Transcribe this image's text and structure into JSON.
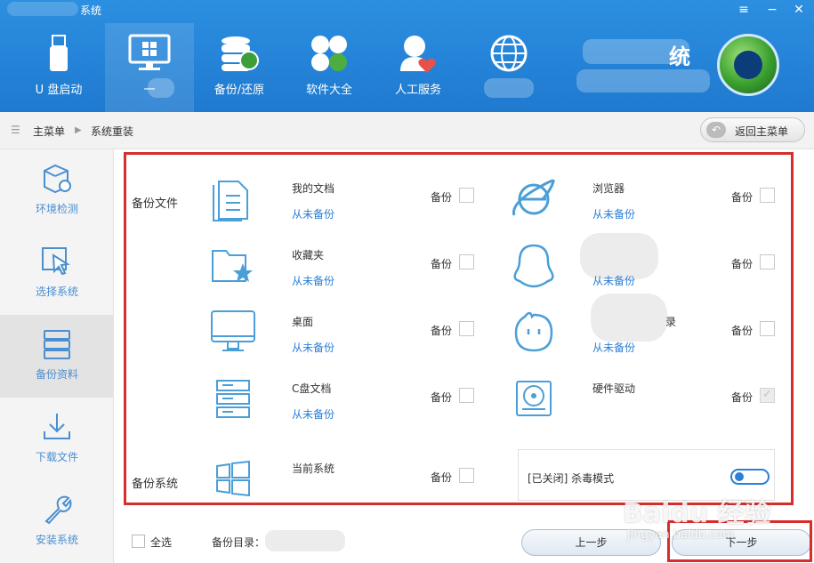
{
  "window": {
    "title": "系统",
    "controls": [
      "≡",
      "−",
      "✕"
    ]
  },
  "nav": {
    "tabs": [
      {
        "label": "U 盘启动",
        "icon": "usb-icon"
      },
      {
        "label": "一",
        "icon": "monitor-windows-icon"
      },
      {
        "label": "备份/还原",
        "icon": "database-icon"
      },
      {
        "label": "软件大全",
        "icon": "apps-icon"
      },
      {
        "label": "人工服务",
        "icon": "user-heart-icon"
      },
      {
        "label": "",
        "icon": "globe-icon"
      }
    ],
    "brand": "统"
  },
  "breadcrumb": {
    "root": "主菜单",
    "current": "系统重装",
    "back_label": "返回主菜单"
  },
  "sidebar": {
    "items": [
      {
        "label": "环境检测",
        "icon": "box-gear-icon"
      },
      {
        "label": "选择系统",
        "icon": "cursor-icon"
      },
      {
        "label": "备份资料",
        "icon": "server-icon"
      },
      {
        "label": "下载文件",
        "icon": "download-icon"
      },
      {
        "label": "安装系统",
        "icon": "wrench-icon"
      }
    ]
  },
  "backup": {
    "files_label": "备份文件",
    "system_label": "备份系统",
    "checkbox_label": "备份",
    "left_items": [
      {
        "name": "我的文档",
        "status": "从未备份"
      },
      {
        "name": "收藏夹",
        "status": "从未备份"
      },
      {
        "name": "桌面",
        "status": "从未备份"
      },
      {
        "name": "C盘文档",
        "status": "从未备份"
      }
    ],
    "right_items": [
      {
        "name": "浏览器",
        "status": "从未备份"
      },
      {
        "name": "",
        "status": "从未备份"
      },
      {
        "name": "录",
        "status": "从未备份"
      },
      {
        "name": "硬件驱动",
        "status": ""
      }
    ],
    "system_item": "当前系统",
    "antivirus_label": "[已关闭] 杀毒模式"
  },
  "footer": {
    "select_all": "全选",
    "backup_dir_label": "备份目录：",
    "prev_label": "上一步",
    "next_label": "下一步",
    "watermark": "Baidu 经验",
    "watermark_url": "jingyan.baidu.com"
  }
}
